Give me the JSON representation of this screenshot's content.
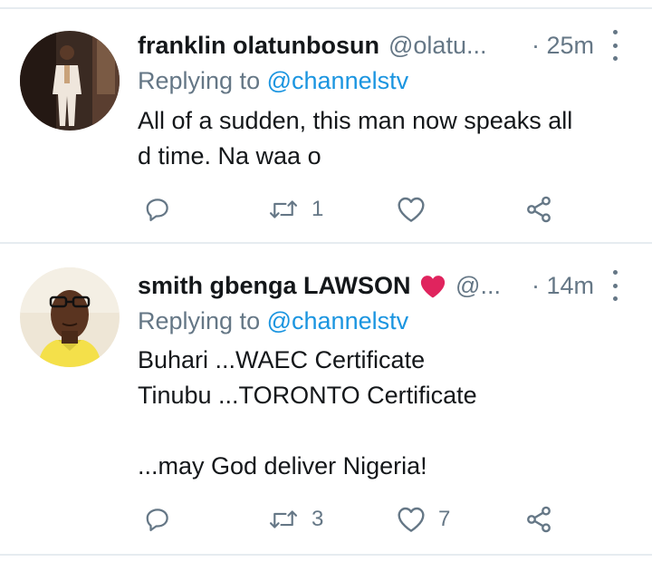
{
  "tweets": [
    {
      "display_name": "franklin olatunbosun",
      "handle": "@olatu...",
      "time": "25m",
      "replying_prefix": "Replying to",
      "replying_to": "@channelstv",
      "text": "All of a sudden, this man now speaks all\nd time. Na waa o",
      "reply_count": "",
      "retweet_count": "1",
      "like_count": ""
    },
    {
      "display_name": "smith gbenga LAWSON",
      "handle": "@...",
      "time": "14m",
      "replying_prefix": "Replying to",
      "replying_to": "@channelstv",
      "text": "Buhari ...WAEC Certificate\nTinubu ...TORONTO Certificate\n\n...may God deliver Nigeria!",
      "reply_count": "",
      "retweet_count": "3",
      "like_count": "7"
    }
  ],
  "icons": {
    "reply": "reply-icon",
    "retweet": "retweet-icon",
    "like": "heart-icon",
    "share": "share-icon",
    "more": "more-vertical-icon",
    "emoji": "red-heart-emoji"
  },
  "colors": {
    "secondary_text": "#657786",
    "mention": "#1b95e0",
    "divider": "#e6ecf0",
    "heart_emoji": "#e0245e"
  }
}
